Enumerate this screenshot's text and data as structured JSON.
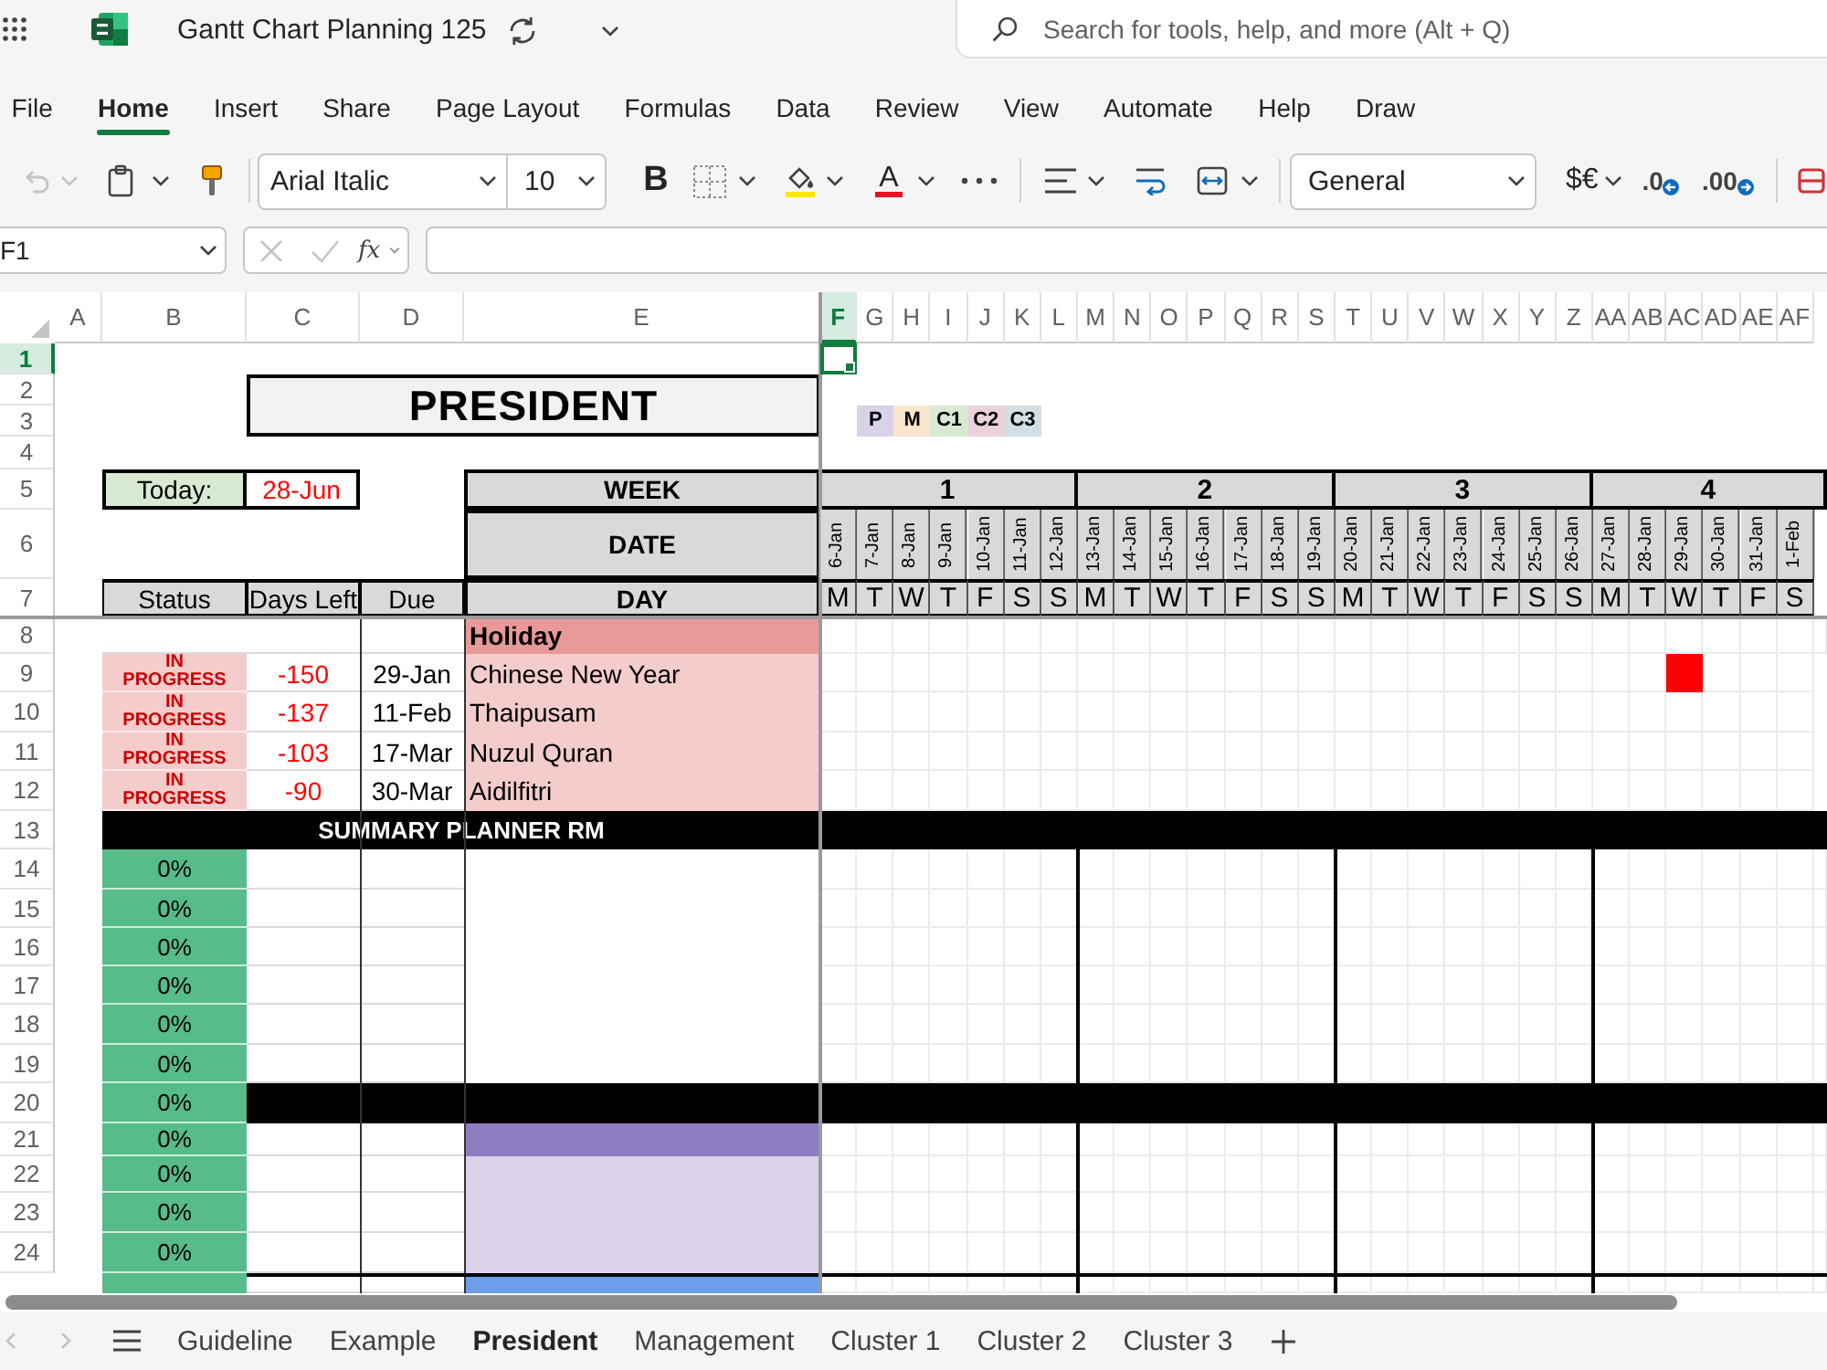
{
  "titlebar": {
    "title": "Gantt Chart Planning 125",
    "search": {
      "placeholder": "Search for tools, help, and more (Alt + Q)"
    }
  },
  "menu_tabs": [
    {
      "label": "File",
      "selected": false
    },
    {
      "label": "Home",
      "selected": true
    },
    {
      "label": "Insert",
      "selected": false
    },
    {
      "label": "Share",
      "selected": false
    },
    {
      "label": "Page Layout",
      "selected": false
    },
    {
      "label": "Formulas",
      "selected": false
    },
    {
      "label": "Data",
      "selected": false
    },
    {
      "label": "Review",
      "selected": false
    },
    {
      "label": "View",
      "selected": false
    },
    {
      "label": "Automate",
      "selected": false
    },
    {
      "label": "Help",
      "selected": false
    },
    {
      "label": "Draw",
      "selected": false
    }
  ],
  "toolbar": {
    "undo": {
      "disabled": true
    },
    "font": "Arial Italic",
    "font_size": "10",
    "bold": "B",
    "font_color": "A",
    "number_format": "General",
    "currency": "$€",
    "decrease_decimal": ".0",
    "increase_decimal": ".00"
  },
  "formula_bar": {
    "name_box": "F1",
    "cancel": {
      "disabled": true
    },
    "enter": {
      "disabled": true
    },
    "function_button": "fx"
  },
  "sheet": {
    "column_headers": [
      {
        "label": "A",
        "selected": false
      },
      {
        "label": "B",
        "selected": false
      },
      {
        "label": "C",
        "selected": false
      },
      {
        "label": "D",
        "selected": false
      },
      {
        "label": "E",
        "selected": false
      },
      {
        "label": "F",
        "selected": true
      },
      {
        "label": "G",
        "selected": false
      },
      {
        "label": "H",
        "selected": false
      },
      {
        "label": "I",
        "selected": false
      },
      {
        "label": "J",
        "selected": false
      },
      {
        "label": "K",
        "selected": false
      },
      {
        "label": "L",
        "selected": false
      },
      {
        "label": "M",
        "selected": false
      },
      {
        "label": "N",
        "selected": false
      },
      {
        "label": "O",
        "selected": false
      },
      {
        "label": "P",
        "selected": false
      },
      {
        "label": "Q",
        "selected": false
      },
      {
        "label": "R",
        "selected": false
      },
      {
        "label": "S",
        "selected": false
      },
      {
        "label": "T",
        "selected": false
      },
      {
        "label": "U",
        "selected": false
      },
      {
        "label": "V",
        "selected": false
      },
      {
        "label": "W",
        "selected": false
      },
      {
        "label": "X",
        "selected": false
      },
      {
        "label": "Y",
        "selected": false
      },
      {
        "label": "Z",
        "selected": false
      },
      {
        "label": "AA",
        "selected": false
      },
      {
        "label": "AB",
        "selected": false
      },
      {
        "label": "AC",
        "selected": false
      },
      {
        "label": "AD",
        "selected": false
      },
      {
        "label": "AE",
        "selected": false
      },
      {
        "label": "AF",
        "selected": false
      }
    ],
    "row_headers": [
      {
        "label": "1",
        "selected": true
      },
      {
        "label": "2",
        "selected": false
      },
      {
        "label": "3",
        "selected": false
      },
      {
        "label": "4",
        "selected": false
      },
      {
        "label": "5",
        "selected": false
      },
      {
        "label": "6",
        "selected": false
      },
      {
        "label": "7",
        "selected": false
      },
      {
        "label": "8",
        "selected": false
      },
      {
        "label": "9",
        "selected": false
      },
      {
        "label": "10",
        "selected": false
      },
      {
        "label": "11",
        "selected": false
      },
      {
        "label": "12",
        "selected": false
      },
      {
        "label": "13",
        "selected": false
      },
      {
        "label": "14",
        "selected": false
      },
      {
        "label": "15",
        "selected": false
      },
      {
        "label": "16",
        "selected": false
      },
      {
        "label": "17",
        "selected": false
      },
      {
        "label": "18",
        "selected": false
      },
      {
        "label": "19",
        "selected": false
      },
      {
        "label": "20",
        "selected": false
      },
      {
        "label": "21",
        "selected": false
      },
      {
        "label": "22",
        "selected": false
      },
      {
        "label": "23",
        "selected": false
      },
      {
        "label": "24",
        "selected": false
      }
    ],
    "title": "PRESIDENT",
    "legend": [
      {
        "label": "P",
        "color": "#d9d2e9"
      },
      {
        "label": "M",
        "color": "#fce5cd"
      },
      {
        "label": "C1",
        "color": "#d9ead3"
      },
      {
        "label": "C2",
        "color": "#ead1dc"
      },
      {
        "label": "C3",
        "color": "#d0e0e3"
      }
    ],
    "today": {
      "label": "Today:",
      "value": "28-Jun"
    },
    "week_heading": "WEEK",
    "date_heading": "DATE",
    "day_heading": "DAY",
    "weeks": [
      "1",
      "2",
      "3",
      "4"
    ],
    "dates": [
      "6-Jan",
      "7-Jan",
      "8-Jan",
      "9-Jan",
      "10-Jan",
      "11-Jan",
      "12-Jan",
      "13-Jan",
      "14-Jan",
      "15-Jan",
      "16-Jan",
      "17-Jan",
      "18-Jan",
      "19-Jan",
      "20-Jan",
      "21-Jan",
      "22-Jan",
      "23-Jan",
      "24-Jan",
      "25-Jan",
      "26-Jan",
      "27-Jan",
      "28-Jan",
      "29-Jan",
      "30-Jan",
      "31-Jan",
      "1-Feb"
    ],
    "days": [
      "M",
      "T",
      "W",
      "T",
      "F",
      "S",
      "S",
      "M",
      "T",
      "W",
      "T",
      "F",
      "S",
      "S",
      "M",
      "T",
      "W",
      "T",
      "F",
      "S",
      "S",
      "M",
      "T",
      "W",
      "T",
      "F",
      "S"
    ],
    "column_titles": [
      "Status",
      "Days Left",
      "Due"
    ],
    "holiday_heading": "Holiday",
    "holidays": [
      {
        "status": "IN PROGRESS",
        "days_left": "-150",
        "due": "29-Jan",
        "name": "Chinese New Year",
        "timeline": [
          false,
          false,
          false,
          false,
          false,
          false,
          false,
          false,
          false,
          false,
          false,
          false,
          false,
          false,
          false,
          false,
          false,
          false,
          false,
          false,
          false,
          false,
          false,
          true,
          false,
          false,
          false
        ]
      },
      {
        "status": "IN PROGRESS",
        "days_left": "-137",
        "due": "11-Feb",
        "name": "Thaipusam",
        "timeline": [
          false,
          false,
          false,
          false,
          false,
          false,
          false,
          false,
          false,
          false,
          false,
          false,
          false,
          false,
          false,
          false,
          false,
          false,
          false,
          false,
          false,
          false,
          false,
          false,
          false,
          false,
          false
        ]
      },
      {
        "status": "IN PROGRESS",
        "days_left": "-103",
        "due": "17-Mar",
        "name": "Nuzul Quran",
        "timeline": [
          false,
          false,
          false,
          false,
          false,
          false,
          false,
          false,
          false,
          false,
          false,
          false,
          false,
          false,
          false,
          false,
          false,
          false,
          false,
          false,
          false,
          false,
          false,
          false,
          false,
          false,
          false
        ]
      },
      {
        "status": "IN PROGRESS",
        "days_left": "-90",
        "due": "30-Mar",
        "name": "Aidilfitri",
        "timeline": [
          false,
          false,
          false,
          false,
          false,
          false,
          false,
          false,
          false,
          false,
          false,
          false,
          false,
          false,
          false,
          false,
          false,
          false,
          false,
          false,
          false,
          false,
          false,
          false,
          false,
          false,
          false
        ]
      }
    ],
    "summary_heading": "SUMMARY PLANNER RM",
    "tasks": [
      {
        "kind": "task",
        "status": "0%"
      },
      {
        "kind": "task",
        "status": "0%"
      },
      {
        "kind": "task",
        "status": "0%"
      },
      {
        "kind": "task",
        "status": "0%"
      },
      {
        "kind": "task",
        "status": "0%"
      },
      {
        "kind": "task",
        "status": "0%"
      },
      {
        "kind": "section",
        "status": "0%"
      },
      {
        "kind": "task",
        "status": "0%",
        "color": "#8e7cc3"
      },
      {
        "kind": "task",
        "status": "0%",
        "color": "#d9d2e9"
      },
      {
        "kind": "task",
        "status": "0%",
        "color": "#d9d2e9"
      },
      {
        "kind": "task",
        "status": "0%",
        "color": "#d9d2e9"
      },
      {
        "kind": "cut",
        "color": "#6d9eeb"
      }
    ]
  },
  "sheet_tabs": {
    "back": {
      "disabled": true
    },
    "forward": {
      "disabled": true
    },
    "tabs": [
      {
        "label": "Guideline",
        "selected": false
      },
      {
        "label": "Example",
        "selected": false
      },
      {
        "label": "President",
        "selected": true
      },
      {
        "label": "Management",
        "selected": false
      },
      {
        "label": "Cluster 1",
        "selected": false
      },
      {
        "label": "Cluster 2",
        "selected": false
      },
      {
        "label": "Cluster 3",
        "selected": false
      }
    ]
  }
}
